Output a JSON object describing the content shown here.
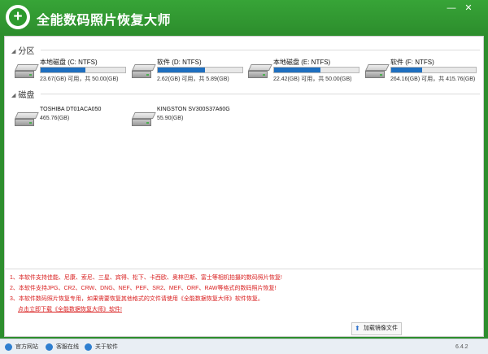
{
  "window": {
    "title": "全能数码照片恢复大师",
    "minimize_glyph": "—",
    "close_glyph": "✕"
  },
  "sections": {
    "partitions": "分区",
    "disks": "磁盘"
  },
  "partitions": [
    {
      "name": "本地磁盘 (C: NTFS)",
      "size": "23.67(GB) 可用，共 50.00(GB)",
      "used_fraction": 0.53
    },
    {
      "name": "软件 (D: NTFS)",
      "size": "2.62(GB) 可用，共 5.89(GB)",
      "used_fraction": 0.56
    },
    {
      "name": "本地磁盘 (E: NTFS)",
      "size": "22.42(GB) 可用，共 50.00(GB)",
      "used_fraction": 0.55
    },
    {
      "name": "软件 (F: NTFS)",
      "size": "264.16(GB) 可用，共 415.76(GB)",
      "used_fraction": 0.37
    }
  ],
  "disks": [
    {
      "name": "TOSHIBA DT01ACA050",
      "size": "465.76(GB)"
    },
    {
      "name": "KINGSTON SV300S37A60G",
      "size": "55.90(GB)"
    }
  ],
  "notes": [
    "1、本软件支持佳能、尼康、索尼、三星、宾得、松下、卡西欧、奥林巴斯、富士等相机拍摄的数码照片恢复!",
    "2、本软件支持JPG、CR2、CRW、DNG、NEF、PEF、SR2、MEF、ORF、RAW等格式的数码照片恢复!",
    "3、本软件数码照片恢复专用，如果需要恢复其他格式的文件请使用《全能数据恢复大师》软件恢复。"
  ],
  "download_link": "点击立即下载《全能数据恢复大师》软件!",
  "load_button": "加载镜像文件",
  "status": {
    "official_site": "官方网站",
    "online_service": "客服在线",
    "about": "关于软件",
    "version": "6.4.2"
  },
  "colors": {
    "accent_green": "#2d8e2d",
    "progress_blue": "#1e6fc0",
    "note_red": "#d92020"
  }
}
